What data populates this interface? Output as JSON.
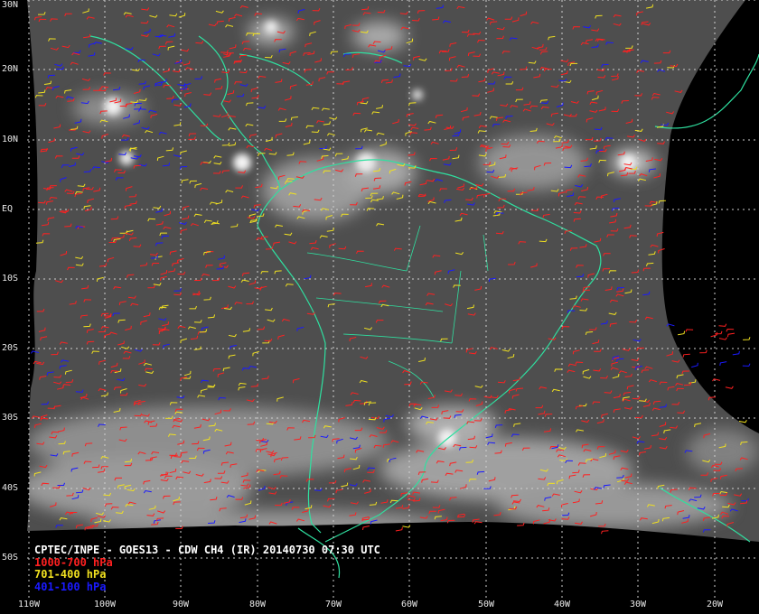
{
  "caption": {
    "title": "CPTEC/INPE - GOES13 - CDW CH4 (IR) 20140730 07:30 UTC"
  },
  "legend": [
    {
      "label": "1000-700 hPa",
      "color": "#ff2020"
    },
    {
      "label": "701-400 hPa",
      "color": "#f0e020"
    },
    {
      "label": "401-100 hPa",
      "color": "#1a1aff"
    }
  ],
  "latitudes": [
    "30N",
    "20N",
    "10N",
    "EQ",
    "10S",
    "20S",
    "30S",
    "40S",
    "50S"
  ],
  "longitudes": [
    "110W",
    "100W",
    "90W",
    "80W",
    "70W",
    "60W",
    "50W",
    "40W",
    "30W",
    "20W"
  ],
  "colors": {
    "background": "#000000",
    "coastline": "#2fe0a0",
    "gridline": "#d0d0d0",
    "label": "#e8e8e8"
  }
}
